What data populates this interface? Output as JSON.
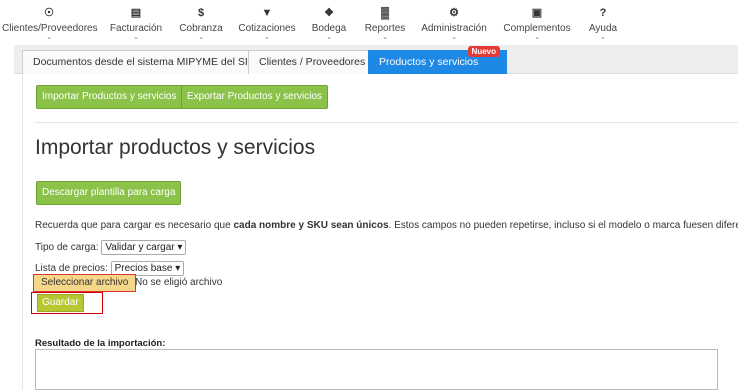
{
  "nav": [
    {
      "icon": "users-icon",
      "glyph": "☉",
      "label": "Clientes/Proveedores"
    },
    {
      "icon": "invoice-icon",
      "glyph": "▤",
      "label": "Facturación"
    },
    {
      "icon": "dollar-icon",
      "glyph": "$",
      "label": "Cobranza"
    },
    {
      "icon": "cart-icon",
      "glyph": "▼",
      "label": "Cotizaciones"
    },
    {
      "icon": "cubes-icon",
      "glyph": "❖",
      "label": "Bodega"
    },
    {
      "icon": "bar-chart-icon",
      "glyph": "▓",
      "label": "Reportes"
    },
    {
      "icon": "cogs-icon",
      "glyph": "⚙",
      "label": "Administración"
    },
    {
      "icon": "puzzle-icon",
      "glyph": "▣",
      "label": "Complementos"
    },
    {
      "icon": "help-icon",
      "glyph": "?",
      "label": "Ayuda"
    }
  ],
  "tabs": [
    {
      "label": "Documentos desde el sistema MIPYME del SII",
      "active": false
    },
    {
      "label": "Clientes / Proveedores",
      "active": false
    },
    {
      "label": "Productos y servicios",
      "active": true,
      "badge": "Nuevo"
    }
  ],
  "actions": {
    "import_label": "Importar Productos y servicios",
    "export_label": "Exportar Productos y servicios"
  },
  "page_title": "Importar productos y servicios",
  "template_button": "Descargar plantilla para carga",
  "note": {
    "before": "Recuerda que para cargar es necesario que ",
    "bold": "cada nombre y SKU sean únicos",
    "after": ". Estos campos no pueden repetirse, incluso si el modelo o marca fuesen diferente"
  },
  "form": {
    "load_type_label": "Tipo de carga:",
    "load_type_value": "Validar y cargar",
    "price_list_label": "Lista de precios:",
    "price_list_value": "Precios base",
    "file_button": "Seleccionar archivo",
    "file_status": "No se eligió archivo",
    "save_label": "Guardar"
  },
  "result": {
    "label": "Resultado de la importación:",
    "value": ""
  },
  "colors": {
    "accent_blue": "#1e88e5",
    "button_green": "#8bc34a",
    "badge_red": "#e53935"
  }
}
